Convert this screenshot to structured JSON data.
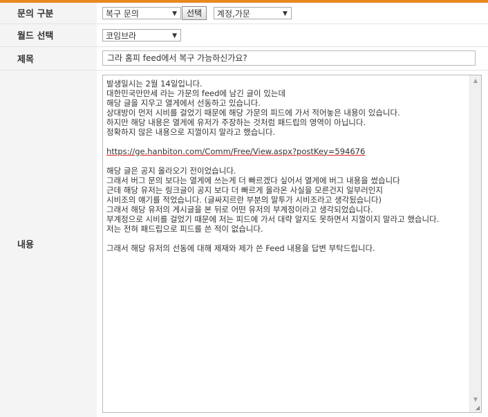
{
  "form": {
    "inquiry_type": {
      "label": "문의 구분",
      "category_value": "복구 문의",
      "select_button": "선택",
      "subcategory_value": "계정,가문"
    },
    "world_select": {
      "label": "월드 선택",
      "value": "코임브라"
    },
    "subject": {
      "label": "제목",
      "value": "그라 홈피 feed에서 복구 가능하신가요?"
    },
    "content": {
      "label": "내용",
      "lines_1": [
        "발생일시는 2월 14일입니다.",
        "대한민국만만세 라는 가문의 feed에 남긴 글이 있는데",
        "해당 글을 지우고 열게에서 선동하고 있습니다.",
        "상대방이 먼저 시비를 걸었기 때문에 해당 가문의 피드에 가서 적어놓은 내용이 있습니다.",
        "하지만 해당 내용은 열게에 유저가 주장하는 것처럼 패드립의 영역이 아닙니다.",
        "정확하지 않은 내용으로 지껄이지 말라고 했습니다."
      ],
      "url": "https://ge.hanbiton.com/Comm/Free/View.aspx?postKey=594676",
      "lines_2": [
        "해당 글은 공지 올라오기 전이었습니다.",
        "그래서 버그 문의 보다는 열게에 쓰는게 더 빠르겠다 싶어서 열게에 버그 내용을 썼습니다",
        "근데 해당 유저는 링크글이 공지 보다 더 빠르게 올라온 사실을 모른건지 일부러인지",
        "시비조의 얘기를 적었습니다. (글싸지르란 부분의 말투가 시비조라고 생각됬습니다)",
        "그래서 해당 유저의 게시글을 본 뒤로 어떤 유저의 부계정이라고 생각되었습니다.",
        "부계정으로 시비를 걸었기 때문에 저는 피드에 가서 대략 알지도 못하면서 지껄이지 말라고 했습니다.",
        "저는 전혀 패드립으로 피드를 쓴 적이 없습니다."
      ],
      "closing": "그래서 해당 유저의 선동에 대해 제재와 제가 쓴 Feed 내용을 답변 부탁드립니다."
    }
  },
  "colors": {
    "accent_bar": "#e8891f",
    "label_bg": "#f4f4f4"
  },
  "icons": {
    "dropdown_arrow": "chevron-down-icon",
    "scroll_up": "scroll-up-icon",
    "scroll_down": "scroll-down-icon",
    "resize_grip": "resize-grip-icon"
  }
}
